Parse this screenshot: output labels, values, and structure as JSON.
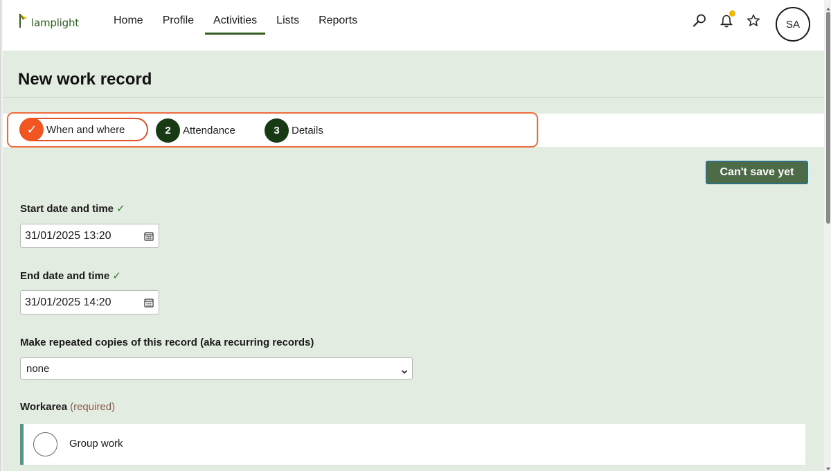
{
  "app": {
    "logo_text": "lamplight",
    "accent": "#2f5d22"
  },
  "nav": {
    "items": [
      {
        "label": "Home"
      },
      {
        "label": "Profile"
      },
      {
        "label": "Activities",
        "active": true
      },
      {
        "label": "Lists"
      },
      {
        "label": "Reports"
      }
    ]
  },
  "header_icons": {
    "search": "search-icon",
    "notifications": "bell-icon",
    "favourites": "star-icon",
    "notification_dot_color": "#f2b705"
  },
  "user": {
    "initials": "SA"
  },
  "page": {
    "title": "New work record"
  },
  "stepper": {
    "steps": [
      {
        "marker": "✓",
        "label": "When and where",
        "state": "current-complete"
      },
      {
        "marker": "2",
        "label": "Attendance",
        "state": "pending"
      },
      {
        "marker": "3",
        "label": "Details",
        "state": "pending"
      }
    ],
    "highlight_color": "#f06a3e"
  },
  "actions": {
    "save_label": "Can't save yet"
  },
  "form": {
    "start": {
      "label": "Start date and time",
      "valid_mark": "✓",
      "value": "31/01/2025 13:20"
    },
    "end": {
      "label": "End date and time",
      "valid_mark": "✓",
      "value": "31/01/2025 14:20"
    },
    "repeat": {
      "label": "Make repeated copies of this record (aka recurring records)",
      "selected": "none"
    },
    "workarea": {
      "label": "Workarea",
      "required_note": "(required)",
      "options": [
        {
          "label": "Group work",
          "selected": false
        }
      ]
    }
  }
}
